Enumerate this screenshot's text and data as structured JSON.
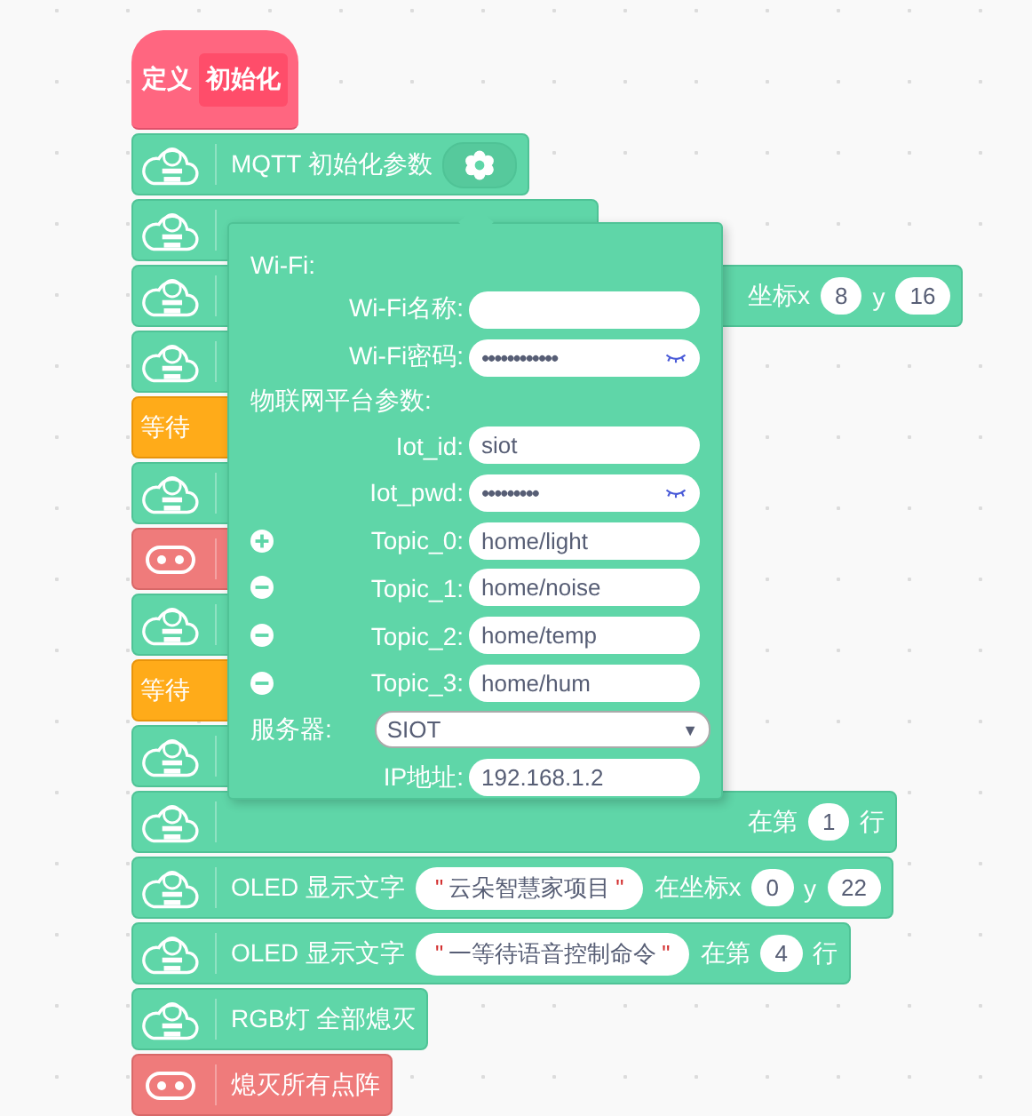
{
  "define_block": {
    "keyword": "定义",
    "name": "初始化"
  },
  "blocks": [
    {
      "kind": "cloud",
      "covered": false,
      "parts": [
        {
          "kind": "label",
          "text": "MQTT 初始化参数"
        },
        {
          "kind": "gear"
        }
      ]
    },
    {
      "kind": "cloud",
      "covered": true
    },
    {
      "kind": "cloud",
      "covered": true,
      "parts": [
        {
          "kind": "label",
          "text": "坐标x"
        },
        {
          "kind": "number",
          "text": "8"
        },
        {
          "kind": "label",
          "text": "y"
        },
        {
          "kind": "number",
          "text": "16"
        }
      ]
    },
    {
      "kind": "cloud",
      "covered": true
    },
    {
      "kind": "wait",
      "covered": true,
      "parts": [
        {
          "kind": "keyword",
          "text": "等待"
        }
      ]
    },
    {
      "kind": "cloud",
      "covered": true
    },
    {
      "kind": "matrix",
      "covered": true
    },
    {
      "kind": "cloud",
      "covered": true
    },
    {
      "kind": "wait",
      "covered": true,
      "parts": [
        {
          "kind": "keyword",
          "text": "等待"
        }
      ]
    },
    {
      "kind": "cloud",
      "covered": true
    },
    {
      "kind": "cloud",
      "covered": true,
      "parts": [
        {
          "kind": "label",
          "text": "在第"
        },
        {
          "kind": "number",
          "text": "1"
        },
        {
          "kind": "label",
          "text": "行"
        }
      ]
    },
    {
      "kind": "cloud",
      "covered": false,
      "parts": [
        {
          "kind": "label",
          "text": "OLED 显示文字"
        },
        {
          "kind": "string",
          "open": "\"",
          "text": "云朵智慧家项目",
          "close": "\""
        },
        {
          "kind": "label",
          "text": "在坐标x"
        },
        {
          "kind": "number",
          "text": "0"
        },
        {
          "kind": "label",
          "text": "y"
        },
        {
          "kind": "number",
          "text": "22"
        }
      ]
    },
    {
      "kind": "cloud",
      "covered": false,
      "parts": [
        {
          "kind": "label",
          "text": "OLED 显示文字"
        },
        {
          "kind": "string",
          "open": "\"",
          "text": "一等待语音控制命令",
          "close": "\""
        },
        {
          "kind": "label",
          "text": "在第"
        },
        {
          "kind": "number",
          "text": "4"
        },
        {
          "kind": "label",
          "text": "行"
        }
      ]
    },
    {
      "kind": "cloud",
      "covered": false,
      "parts": [
        {
          "kind": "label",
          "text": "RGB灯 全部熄灭"
        }
      ]
    },
    {
      "kind": "matrix",
      "covered": false,
      "parts": [
        {
          "kind": "label",
          "text": "熄灭所有点阵"
        }
      ]
    }
  ],
  "popup": {
    "rows": [
      {
        "kind": "header",
        "label": "Wi-Fi:"
      },
      {
        "kind": "field",
        "label": "Wi-Fi名称:"
      },
      {
        "kind": "password",
        "label": "Wi-Fi密码:",
        "value": "••••••••••••"
      },
      {
        "kind": "header",
        "label": "物联网平台参数:"
      },
      {
        "kind": "field",
        "label": "Iot_id:",
        "value": "siot"
      },
      {
        "kind": "password",
        "label": "Iot_pwd:",
        "value": "•••••••••"
      },
      {
        "kind": "field",
        "label": "Topic_0:",
        "value": "home/light",
        "removable": false
      },
      {
        "kind": "field",
        "label": "Topic_1:",
        "value": "home/noise",
        "removable": true
      },
      {
        "kind": "field",
        "label": "Topic_2:",
        "value": "home/temp",
        "removable": true
      },
      {
        "kind": "field",
        "label": "Topic_3:",
        "value": "home/hum",
        "removable": true
      },
      {
        "kind": "select",
        "label": "服务器:",
        "value": "SIOT",
        "arrow": "▼"
      },
      {
        "kind": "field",
        "label": "IP地址:",
        "value": "192.168.1.2"
      }
    ]
  }
}
